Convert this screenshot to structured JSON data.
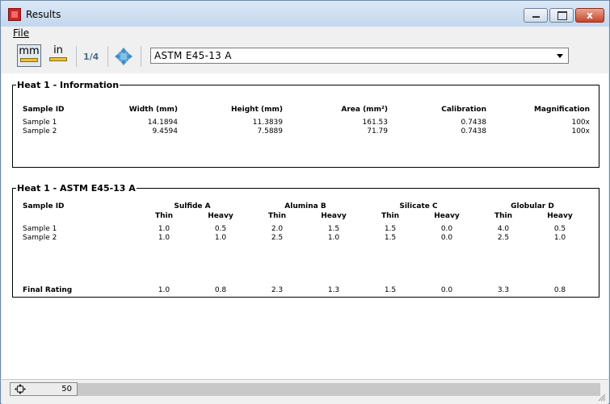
{
  "window": {
    "title": "Results",
    "minimize": "",
    "maximize": "",
    "close": "x"
  },
  "menu": {
    "file": "File"
  },
  "toolbar": {
    "unit_mm": "mm",
    "unit_in": "in",
    "page_indicator": "1/4",
    "standard_select": {
      "selected": "ASTM E45-13  A"
    }
  },
  "info": {
    "legend": "Heat 1 - Information",
    "columns": [
      "Sample ID",
      "Width (mm)",
      "Height (mm)",
      "Area (mm²)",
      "Calibration",
      "Magnification"
    ],
    "rows": [
      [
        "Sample 1",
        "14.1894",
        "11.3839",
        "161.53",
        "0.7438",
        "100x"
      ],
      [
        "Sample 2",
        "9.4594",
        "7.5889",
        "71.79",
        "0.7438",
        "100x"
      ]
    ]
  },
  "rating": {
    "legend": "Heat 1 - ASTM E45-13  A",
    "sample_id_header": "Sample ID",
    "groups": [
      "Sulfide A",
      "Alumina B",
      "Silicate C",
      "Globular D"
    ],
    "subheaders": [
      "Thin",
      "Heavy",
      "Thin",
      "Heavy",
      "Thin",
      "Heavy",
      "Thin",
      "Heavy"
    ],
    "rows": [
      [
        "Sample 1",
        "1.0",
        "0.5",
        "2.0",
        "1.5",
        "1.5",
        "0.0",
        "4.0",
        "0.5"
      ],
      [
        "Sample 2",
        "1.0",
        "1.0",
        "2.5",
        "1.0",
        "1.5",
        "0.0",
        "2.5",
        "1.0"
      ]
    ],
    "final": [
      "Final Rating",
      "1.0",
      "0.8",
      "2.3",
      "1.3",
      "1.5",
      "0.0",
      "3.3",
      "0.8"
    ]
  },
  "status": {
    "zoom": "50"
  },
  "colors": {
    "accent": "#c8242a",
    "ruler": "#e9c23a",
    "page_indicator": "#4b6a8a"
  }
}
